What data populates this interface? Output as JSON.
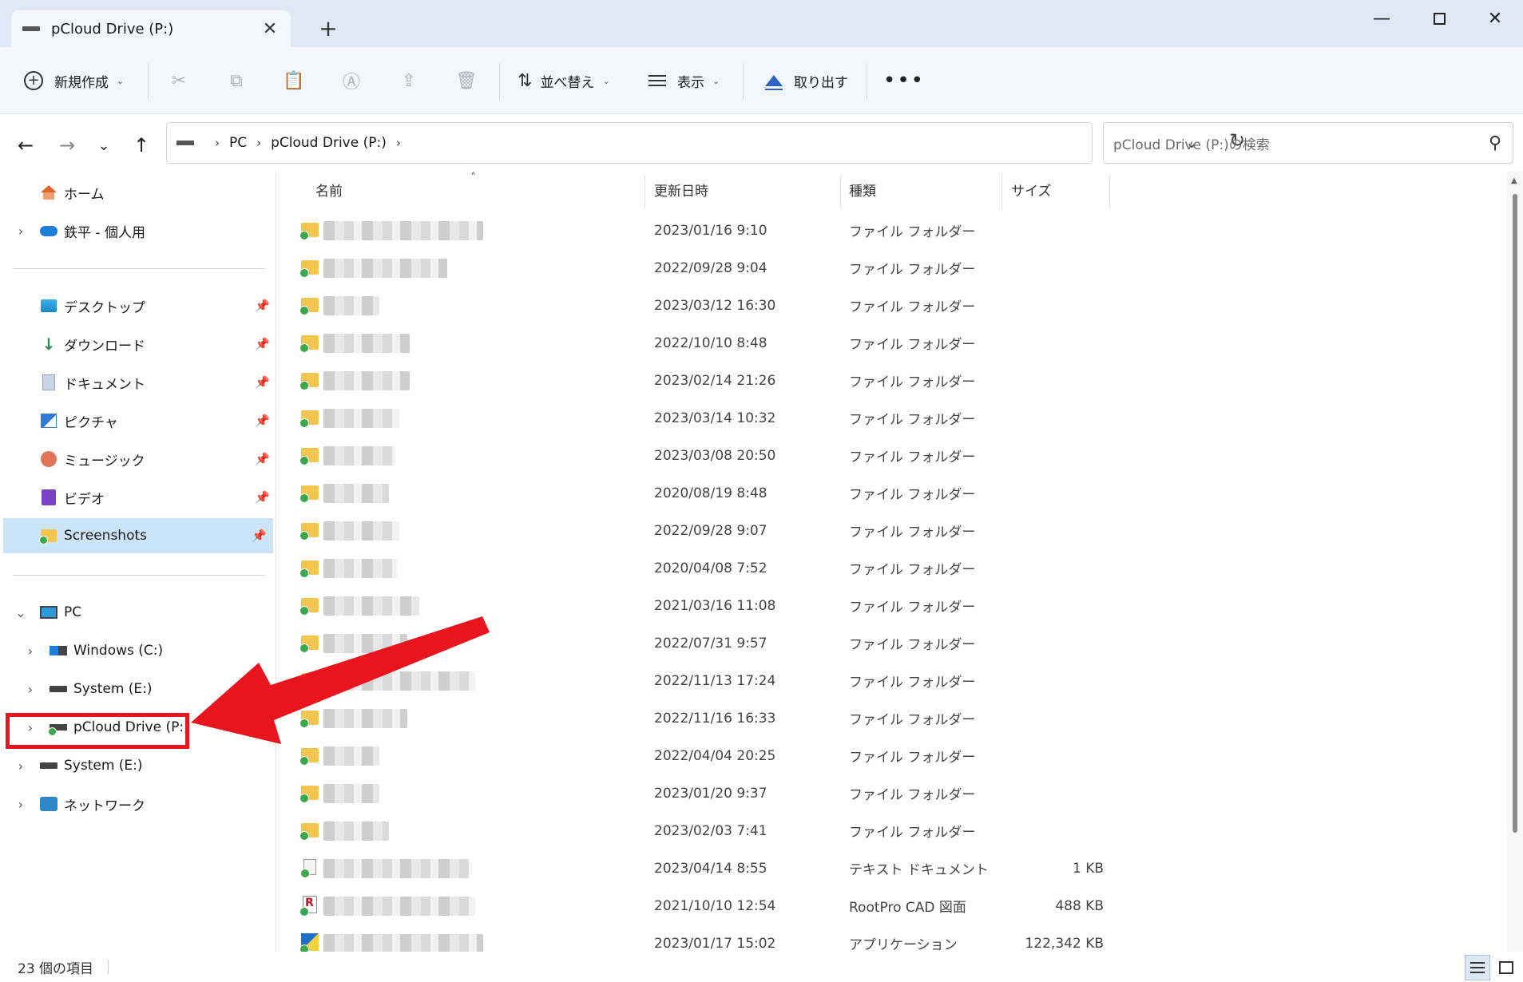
{
  "window": {
    "tab_title": "pCloud Drive (P:)",
    "close_tab_symbol": "✕",
    "new_tab_symbol": "+",
    "minimize_symbol": "—",
    "close_symbol": "✕"
  },
  "commands": {
    "new_label": "新規作成",
    "sort_label": "並べ替え",
    "view_label": "表示",
    "eject_label": "取り出す",
    "more_symbol": "•••",
    "disabled_icons": [
      "cut-icon",
      "copy-icon",
      "paste-icon",
      "rename-icon",
      "share-icon",
      "delete-icon"
    ]
  },
  "address": {
    "crumbs": [
      "PC",
      "pCloud Drive (P:)"
    ],
    "search_placeholder": "pCloud Drive (P:)の検索"
  },
  "sidebar": {
    "home": "ホーム",
    "onedrive": "鉄平 - 個人用",
    "quick": [
      {
        "label": "デスクトップ",
        "icon": "desktop-icon"
      },
      {
        "label": "ダウンロード",
        "icon": "download-icon"
      },
      {
        "label": "ドキュメント",
        "icon": "documents-icon"
      },
      {
        "label": "ピクチャ",
        "icon": "pictures-icon"
      },
      {
        "label": "ミュージック",
        "icon": "music-icon"
      },
      {
        "label": "ビデオ",
        "icon": "videos-icon"
      },
      {
        "label": "Screenshots",
        "icon": "folder-icon"
      }
    ],
    "pc": "PC",
    "drives": [
      {
        "label": "Windows (C:)",
        "icon": "windows-drive-icon"
      },
      {
        "label": "System (E:)",
        "icon": "drive-icon"
      },
      {
        "label": "pCloud Drive (P:)",
        "icon": "pcloud-drive-icon"
      }
    ],
    "system_e": "System (E:)",
    "network": "ネットワーク"
  },
  "columns": {
    "name": "名前",
    "date": "更新日時",
    "type": "種類",
    "size": "サイズ"
  },
  "files": [
    {
      "date": "2023/01/16 9:10",
      "type": "ファイル フォルダー",
      "size": "",
      "kind": "folder"
    },
    {
      "date": "2022/09/28 9:04",
      "type": "ファイル フォルダー",
      "size": "",
      "kind": "folder"
    },
    {
      "date": "2023/03/12 16:30",
      "type": "ファイル フォルダー",
      "size": "",
      "kind": "folder"
    },
    {
      "date": "2022/10/10 8:48",
      "type": "ファイル フォルダー",
      "size": "",
      "kind": "folder"
    },
    {
      "date": "2023/02/14 21:26",
      "type": "ファイル フォルダー",
      "size": "",
      "kind": "folder"
    },
    {
      "date": "2023/03/14 10:32",
      "type": "ファイル フォルダー",
      "size": "",
      "kind": "folder"
    },
    {
      "date": "2023/03/08 20:50",
      "type": "ファイル フォルダー",
      "size": "",
      "kind": "folder"
    },
    {
      "date": "2020/08/19 8:48",
      "type": "ファイル フォルダー",
      "size": "",
      "kind": "folder"
    },
    {
      "date": "2022/09/28 9:07",
      "type": "ファイル フォルダー",
      "size": "",
      "kind": "folder"
    },
    {
      "date": "2020/04/08 7:52",
      "type": "ファイル フォルダー",
      "size": "",
      "kind": "folder"
    },
    {
      "date": "2021/03/16 11:08",
      "type": "ファイル フォルダー",
      "size": "",
      "kind": "folder"
    },
    {
      "date": "2022/07/31 9:57",
      "type": "ファイル フォルダー",
      "size": "",
      "kind": "folder"
    },
    {
      "date": "2022/11/13 17:24",
      "type": "ファイル フォルダー",
      "size": "",
      "kind": "folder"
    },
    {
      "date": "2022/11/16 16:33",
      "type": "ファイル フォルダー",
      "size": "",
      "kind": "folder"
    },
    {
      "date": "2022/04/04 20:25",
      "type": "ファイル フォルダー",
      "size": "",
      "kind": "folder"
    },
    {
      "date": "2023/01/20 9:37",
      "type": "ファイル フォルダー",
      "size": "",
      "kind": "folder"
    },
    {
      "date": "2023/02/03 7:41",
      "type": "ファイル フォルダー",
      "size": "",
      "kind": "folder"
    },
    {
      "date": "2023/04/14 8:55",
      "type": "テキスト ドキュメント",
      "size": "1 KB",
      "kind": "text"
    },
    {
      "date": "2021/10/10 12:54",
      "type": "RootPro CAD 図面",
      "size": "488 KB",
      "kind": "cad"
    },
    {
      "date": "2023/01/17 15:02",
      "type": "アプリケーション",
      "size": "122,342 KB",
      "kind": "app"
    }
  ],
  "status": {
    "item_count": "23 個の項目"
  },
  "colors": {
    "highlight_red": "#e8141e",
    "selection_blue": "#cce4f7"
  }
}
